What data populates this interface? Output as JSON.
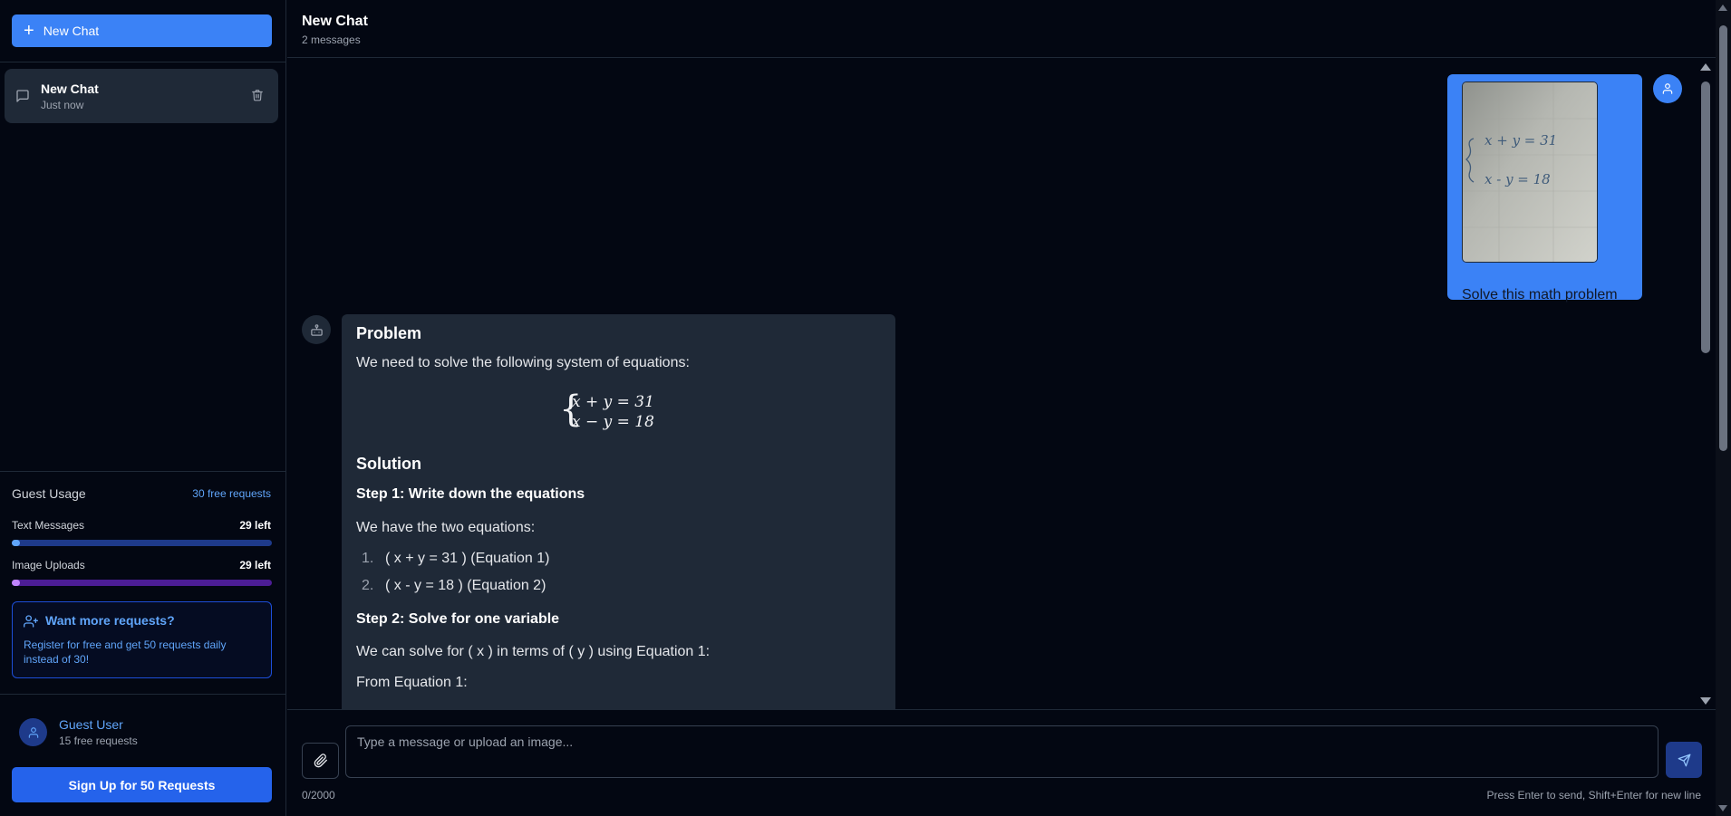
{
  "sidebar": {
    "new_chat_label": "New Chat",
    "chats": [
      {
        "title": "New Chat",
        "time": "Just now"
      }
    ],
    "usage": {
      "title": "Guest Usage",
      "free_label": "30 free requests",
      "text_label": "Text Messages",
      "text_left": "29 left",
      "text_progress": 0.033,
      "image_label": "Image Uploads",
      "image_left": "29 left",
      "image_progress": 0.033
    },
    "promo": {
      "title": "Want more requests?",
      "body": "Register for free and get 50 requests daily instead of 30!"
    },
    "user": {
      "name": "Guest User",
      "sub": "15 free requests"
    },
    "signup_label": "Sign Up for 50 Requests"
  },
  "header": {
    "title": "New Chat",
    "subtitle": "2 messages"
  },
  "messages": {
    "user": {
      "text": "Solve this math problem",
      "image_eq1": "x + y = 31",
      "image_eq2": "x - y = 18"
    },
    "assistant": {
      "h_problem": "Problem",
      "p_intro": "We need to solve the following system of equations:",
      "math_eq1": "x + y = 31",
      "math_eq2": "x − y = 18",
      "h_solution": "Solution",
      "step1_title": "Step 1: Write down the equations",
      "step1_text": "We have the two equations:",
      "list": [
        {
          "num": "1.",
          "text": "( x + y = 31 ) (Equation 1)"
        },
        {
          "num": "2.",
          "text": "( x - y = 18 ) (Equation 2)"
        }
      ],
      "step2_title": "Step 2: Solve for one variable",
      "step2_text": "We can solve for ( x ) in terms of ( y ) using Equation 1:",
      "step2_from": "From Equation 1:"
    }
  },
  "composer": {
    "placeholder": "Type a message or upload an image...",
    "char_count": "0/2000",
    "hint": "Press Enter to send, Shift+Enter for new line"
  },
  "colors": {
    "accent": "#3b82f6",
    "background": "#030712",
    "panel": "#1f2937",
    "text_meter": "#3b82f6",
    "image_meter": "#a855f7"
  }
}
